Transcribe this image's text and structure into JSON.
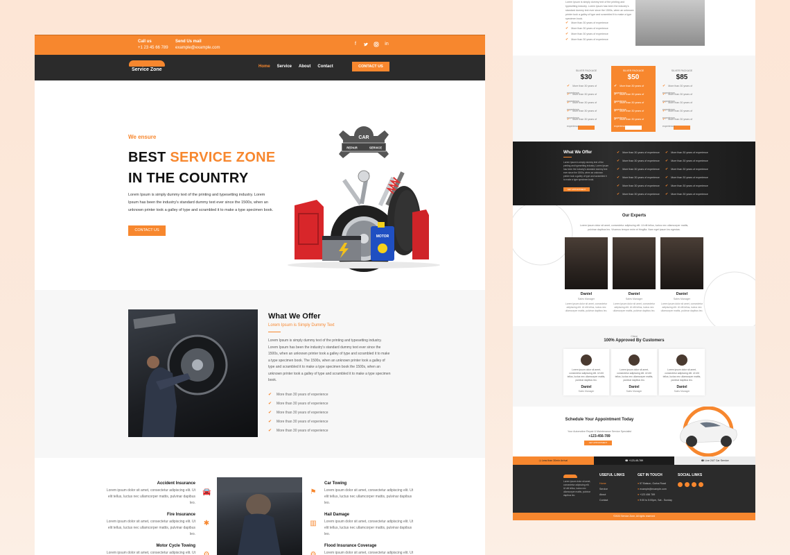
{
  "topbar": {
    "call_label": "Call us",
    "call_value": "+1 23 45 66 789",
    "mail_label": "Send Us mail",
    "mail_value": "example@example.com",
    "social_icons": [
      "facebook-icon",
      "twitter-icon",
      "instagram-icon",
      "linkedin-icon"
    ]
  },
  "navbar": {
    "logo_text": "Service Zone",
    "links": [
      "Home",
      "Service",
      "About",
      "Contact"
    ],
    "cta": "CONTACT US"
  },
  "hero": {
    "eyebrow": "We ensure",
    "title_line1_a": "BEST ",
    "title_line1_b": "SERVICE ZONE",
    "title_line2": "IN THE COUNTRY",
    "body": "Lorem Ipsum is simply dummy text of the printing and typesetting industry. Lorem Ipsum has been the industry's standard dummy text ever since the 1500s, when an unknown printer took a galley of type and scrambled it to make a type specimen book.",
    "button": "CONTACT US",
    "badge_top": "CAR",
    "badge_left": "REPAIR",
    "badge_right": "SERVICE",
    "can_label": "MOTOR"
  },
  "offer": {
    "title": "What We Offer",
    "subtitle": "Lorem Ipsum is Simply Dummy Text",
    "body": "Lorem Ipsum is simply dummy text of the printing and typesetting industry. Lorem Ipsum has been the industry's standard dummy text ever since the 1500s, when an unknown printer took a galley of type and scrambled it to make a type specimen book. The 1500s, when an unknown printer took a galley of type and scrambled it to make a type specimen book the 1500s, when an unknown printer took a galley of type and scrambled it to make a type specimen book.",
    "items": [
      "More than 30 years of experience",
      "More than 30 years of experience",
      "More than 30 years of experience",
      "More than 30 years of experience",
      "More than 30 years of experience"
    ]
  },
  "services": {
    "desc": "Lorem ipsum dolor sit amet, consectetur adipiscing elit. Ut elit tellus, luctus nec ullamcorper mattis, pulvinar dapibus leo.",
    "left": [
      "Accident Insurance",
      "Fire Insurance",
      "Motor Cycle Towing"
    ],
    "right": [
      "Car Towing",
      "Hail Damage",
      "Flood Insurance Coverage"
    ]
  },
  "right": {
    "top_items": [
      "More than 30 years of experience",
      "More than 30 years of experience",
      "More than 30 years of experience",
      "More than 30 years of experience"
    ],
    "pricing": [
      {
        "label": "SILVER PACKAGE",
        "price": "$30",
        "button": "ORDER NOW"
      },
      {
        "label": "SILVER PACKAGE",
        "price": "$50",
        "button": "ORDER NOW"
      },
      {
        "label": "SILVER PACKAGE",
        "price": "$85",
        "button": "ORDER NOW"
      }
    ],
    "pricing_row": "More than 30 years of experience",
    "dark_title": "What We Offer",
    "dark_text": "Lorem Ipsum is simply dummy text of the printing and typesetting industry. Lorem Ipsum has been the industry's standard dummy text ever since the 1500s, when an unknown printer took a galley of type and scrambled it to make a type specimen book.",
    "dark_button": "GET APPOINTMENT",
    "dark_item": "More than 30 years of experience",
    "experts_title": "Our Experts",
    "experts_text": "Lorem ipsum dolor sit amet, consectetur adipiscing elit. Ut elit tellus, luctus nec ullamcorper mattis, pulvinar dapibus leo. Vivamus tempor enim et fringilla. Nam eget ipsum leo egestas.",
    "experts": [
      {
        "name": "Daniel",
        "role": "Sales Manager"
      },
      {
        "name": "Daniel",
        "role": "Sales Manager"
      },
      {
        "name": "Daniel",
        "role": "Sales Manager"
      }
    ],
    "expert_desc": "Lorem ipsum dolor sit amet, consectetur adipiscing elit. Ut elit tellus, luctus nec ullamcorper mattis, pulvinar dapibus leo.",
    "customers_eyebrow": "Client",
    "customers_title": "100% Approved By Customers",
    "testimonial_text": "Lorem ipsum dolor sit amet, consectetur adipiscing elit. Ut elit tellus, luctus nec ullamcorper mattis, pulvinar dapibus leo.",
    "appointment_title": "Schedule Your Appointment Today",
    "appointment_text": "Your Automotive Repair & Maintenance Service Specialist",
    "appointment_phone": "+123-456-789",
    "appointment_button": "GET APPOINTMENT",
    "strip": [
      "Less than 30min Arrival",
      "+123-45-789",
      "Live 24/7 Car Service"
    ],
    "footer_about": "Lorem ipsum dolor sit amet, consectetur adipiscing elit. Ut elit tellus, luctus nec ullamcorper mattis, pulvinar dapibus leo.",
    "useful_title": "USEFUL LINKS",
    "useful_links": [
      "Home",
      "Service",
      "About",
      "Contact"
    ],
    "touch_title": "GET IN TOUCH",
    "touch_items": [
      "57 Batson, Gorba Road",
      "example@example.com",
      "+123 456 789",
      "9:00 to 5:00pm, Sat - Sunday"
    ],
    "social_title": "SOCIAL LINKS",
    "copyright": "©2023 Service Zone, All rights reserved"
  },
  "colors": {
    "accent": "#f7872e",
    "dark": "#2b2b2b"
  }
}
